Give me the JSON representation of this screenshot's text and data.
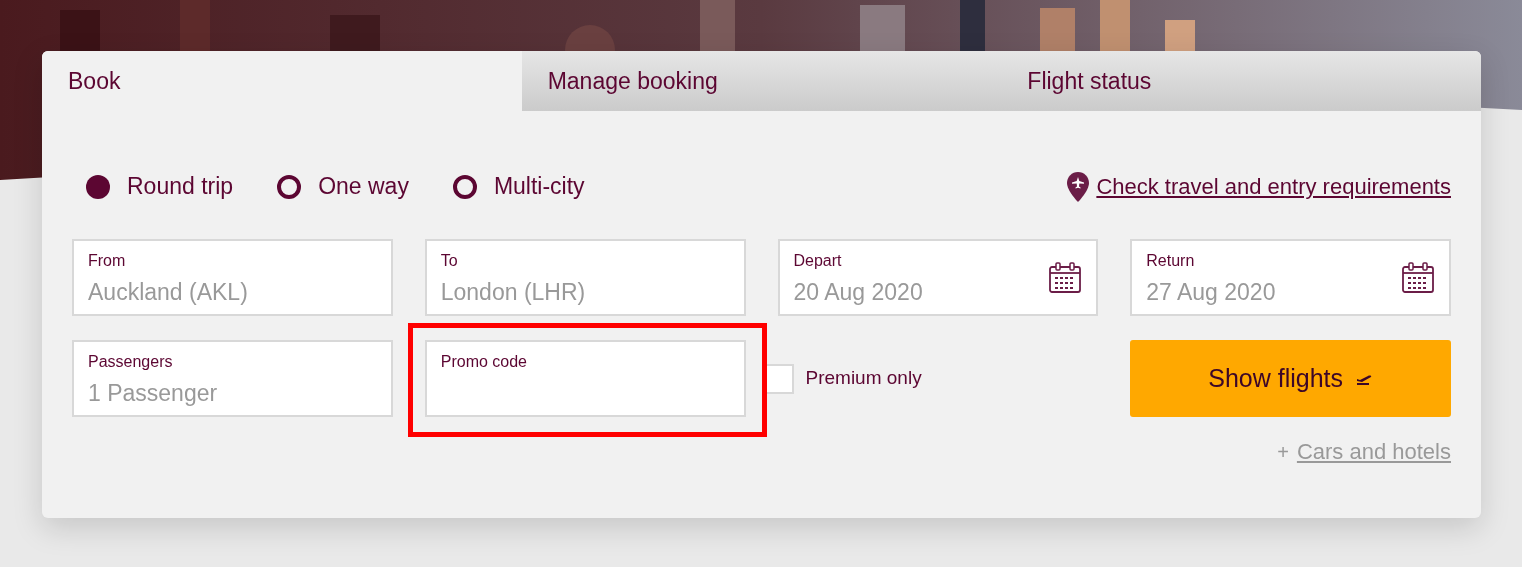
{
  "tabs": [
    {
      "label": "Book",
      "selected": true
    },
    {
      "label": "Manage booking",
      "selected": false
    },
    {
      "label": "Flight status",
      "selected": false
    }
  ],
  "trip_types": [
    {
      "label": "Round trip",
      "selected": true
    },
    {
      "label": "One way",
      "selected": false
    },
    {
      "label": "Multi-city",
      "selected": false
    }
  ],
  "requirements_link": "Check travel and entry requirements",
  "fields": [
    {
      "label": "From",
      "value": "Auckland (AKL)",
      "kind": "text"
    },
    {
      "label": "To",
      "value": "London (LHR)",
      "kind": "text"
    },
    {
      "label": "Depart",
      "value": "20 Aug 2020",
      "kind": "date"
    },
    {
      "label": "Return",
      "value": "27 Aug 2020",
      "kind": "date"
    },
    {
      "label": "Passengers",
      "value": "1 Passenger",
      "kind": "text"
    },
    {
      "label": "Promo code",
      "kind": "text",
      "highlighted": true
    }
  ],
  "premium_only": {
    "label": "Premium only",
    "checked": false
  },
  "show_flights_button": "Show flights",
  "extras_link": {
    "prefix": "+",
    "label": "Cars and hotels"
  }
}
